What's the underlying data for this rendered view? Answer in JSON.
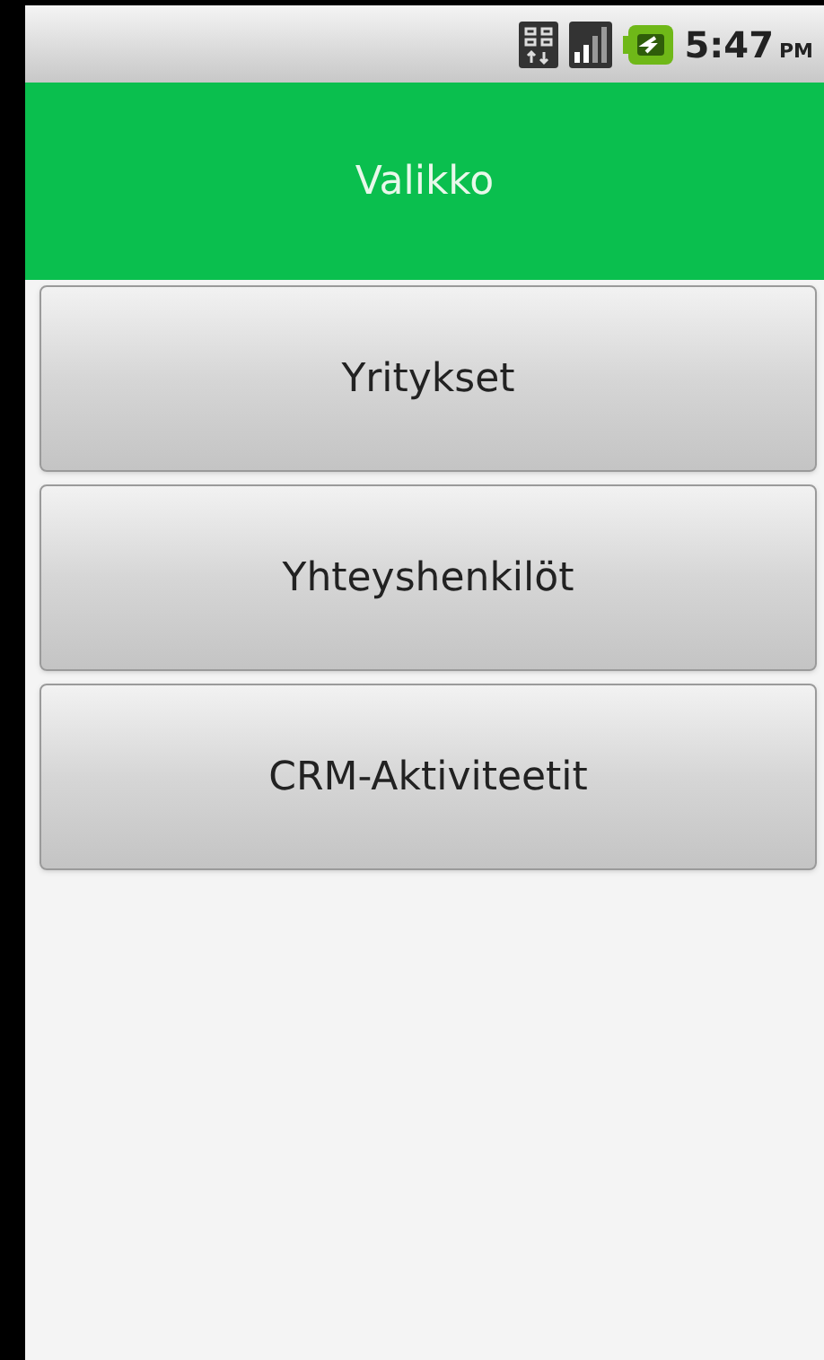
{
  "status_bar": {
    "time": "5:47",
    "ampm": "PM"
  },
  "header": {
    "title": "Valikko"
  },
  "menu": [
    {
      "label": "Yritykset"
    },
    {
      "label": "Yhteyshenkilöt"
    },
    {
      "label": "CRM-Aktiviteetit"
    }
  ]
}
